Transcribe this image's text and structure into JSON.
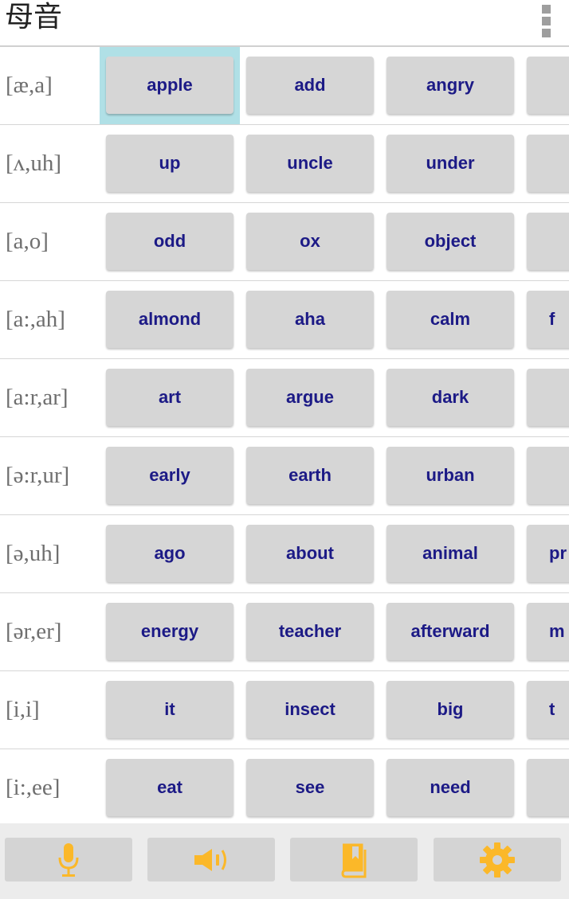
{
  "header": {
    "title": "母音"
  },
  "colors": {
    "accent": "#fbb829",
    "word_text": "#1c1a86",
    "selected_bg": "#b0e0e6"
  },
  "rows": [
    {
      "phonetic": "[æ,a]",
      "words": [
        "apple",
        "add",
        "angry",
        ""
      ]
    },
    {
      "phonetic": "[ʌ,uh]",
      "words": [
        "up",
        "uncle",
        "under",
        ""
      ]
    },
    {
      "phonetic": "[a,o]",
      "words": [
        "odd",
        "ox",
        "object",
        ""
      ]
    },
    {
      "phonetic": "[a:,ah]",
      "words": [
        "almond",
        "aha",
        "calm",
        "f"
      ]
    },
    {
      "phonetic": "[a:r,ar]",
      "words": [
        "art",
        "argue",
        "dark",
        ""
      ]
    },
    {
      "phonetic": "[ə:r,ur]",
      "words": [
        "early",
        "earth",
        "urban",
        ""
      ]
    },
    {
      "phonetic": "[ə,uh]",
      "words": [
        "ago",
        "about",
        "animal",
        "pr"
      ]
    },
    {
      "phonetic": "[ər,er]",
      "words": [
        "energy",
        "teacher",
        "afterward",
        "m"
      ]
    },
    {
      "phonetic": "[i,i]",
      "words": [
        "it",
        "insect",
        "big",
        "t"
      ]
    },
    {
      "phonetic": "[i:,ee]",
      "words": [
        "eat",
        "see",
        "need",
        ""
      ]
    }
  ],
  "toolbar": {
    "buttons": [
      {
        "icon": "microphone-icon"
      },
      {
        "icon": "speaker-icon"
      },
      {
        "icon": "bookmark-book-icon"
      },
      {
        "icon": "gear-icon"
      }
    ]
  }
}
